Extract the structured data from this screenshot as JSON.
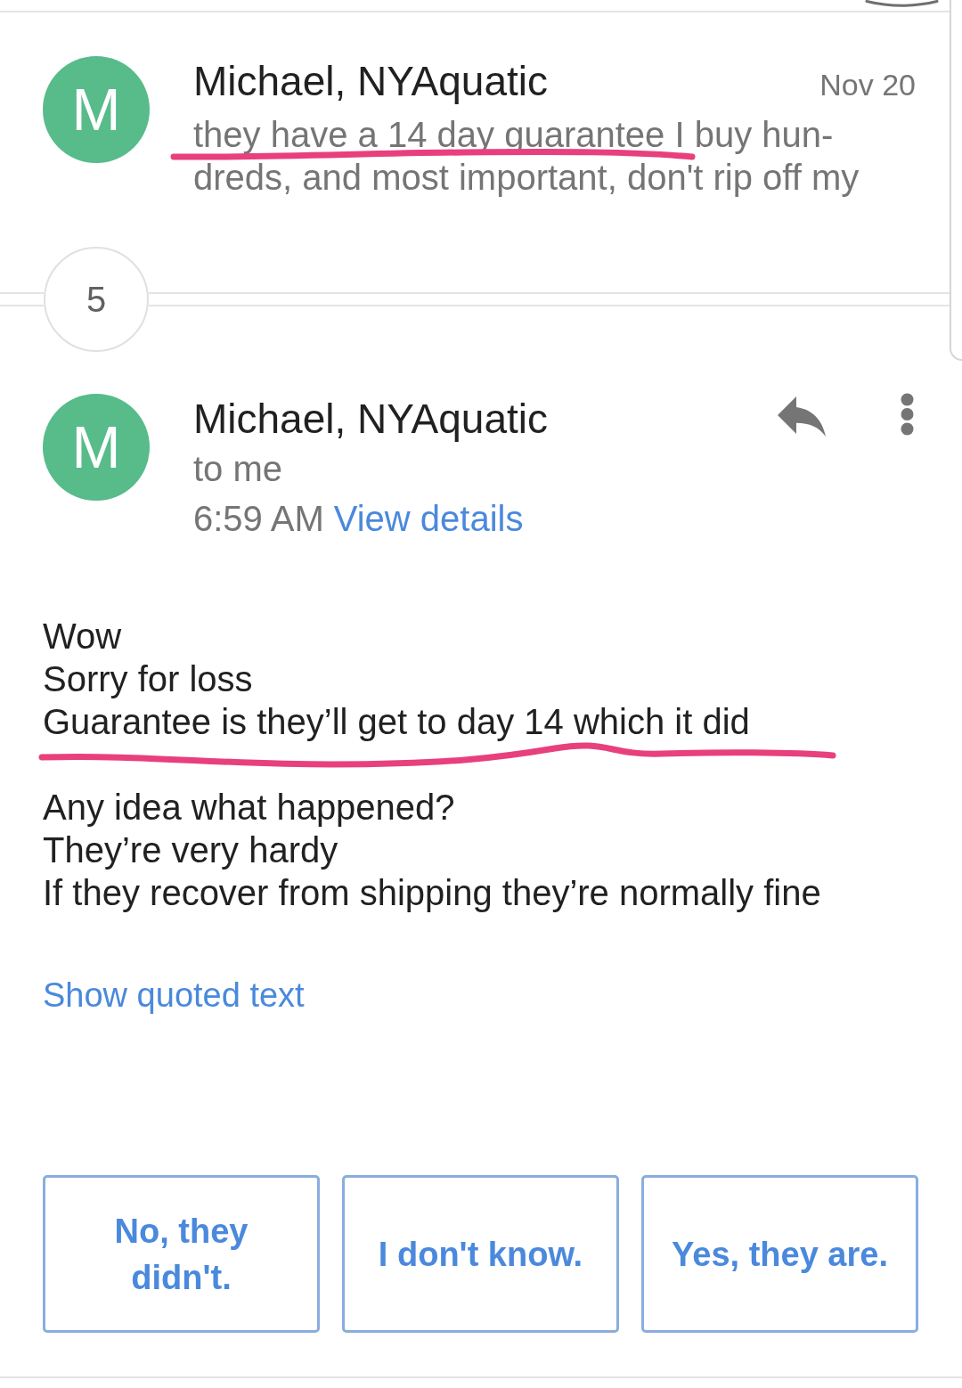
{
  "earlier_message": {
    "avatar_letter": "M",
    "sender": "Michael, NYAquatic",
    "date": "Nov 20",
    "snippet_lines": [
      {
        "text": "they have a 14 day guarantee I buy hun-",
        "underlined": true
      },
      {
        "text": "dreds, and most important, don't rip off my",
        "underlined": false
      }
    ]
  },
  "collapsed_count": "5",
  "message": {
    "avatar_letter": "M",
    "sender": "Michael, NYAquatic",
    "recipient": "to me",
    "time": "6:59 AM",
    "details_link": "View details",
    "paragraphs": [
      {
        "lines": [
          {
            "text": "Wow",
            "underlined": false
          },
          {
            "text": "Sorry for loss",
            "underlined": false
          },
          {
            "text": "Guarantee is they’ll get to day 14 which it did",
            "underlined": true
          }
        ]
      },
      {
        "lines": [
          {
            "text": "Any idea what happened?",
            "underlined": false
          },
          {
            "text": "They’re very hardy",
            "underlined": false
          },
          {
            "text": "If they recover from shipping they’re normally fine",
            "underlined": false
          }
        ]
      }
    ],
    "quoted_link": "Show quoted text"
  },
  "smart_replies": [
    "No, they didn't.",
    "I don't know.",
    "Yes, they are."
  ]
}
